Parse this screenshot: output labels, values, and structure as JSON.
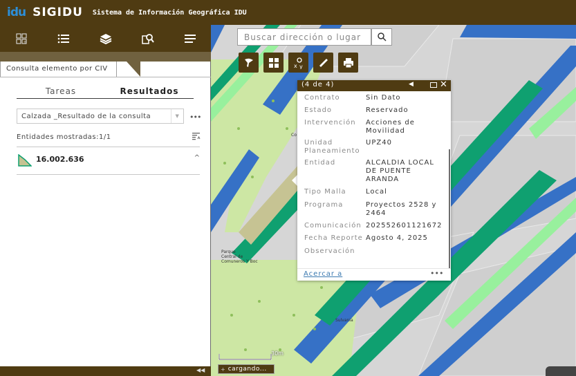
{
  "header": {
    "logo": "idu",
    "title": "SIGIDU",
    "subtitle": "Sistema de Información Geográfica IDU"
  },
  "toolbar": {
    "items": [
      {
        "icon": "widgets-grid-icon"
      },
      {
        "icon": "list-icon"
      },
      {
        "icon": "layers-icon"
      },
      {
        "icon": "query-icon"
      },
      {
        "icon": "menu-icon"
      }
    ]
  },
  "panel": {
    "tab_title": "Consulta elemento por CIV",
    "tabs": [
      "Tareas",
      "Resultados"
    ],
    "active_tab": "Resultados",
    "layer_select": "Calzada _Resultado de la consulta",
    "entities_text": "Entidades mostradas:1/1",
    "result_label": "16.002.636"
  },
  "search": {
    "placeholder": "Buscar dirección o lugar"
  },
  "map_tools": [
    {
      "icon": "draw-icon"
    },
    {
      "icon": "grid-icon"
    },
    {
      "icon": "xy-coordinates-icon"
    },
    {
      "icon": "measure-ruler-icon"
    },
    {
      "icon": "print-icon"
    }
  ],
  "popup": {
    "count": "(4 de 4)",
    "attributes": [
      {
        "key": "Contrato",
        "value": "Sin Dato"
      },
      {
        "key": "Estado",
        "value": "Reservado"
      },
      {
        "key": "Intervención",
        "value": "Acciones de Movilidad"
      },
      {
        "key": "Unidad Planeamiento",
        "value": "UPZ40"
      },
      {
        "key": "Entidad",
        "value": "ALCALDIA LOCAL DE PUENTE ARANDA"
      },
      {
        "key": "Tipo Malla",
        "value": "Local"
      },
      {
        "key": "Programa",
        "value": "Proyectos 2528 y 2464"
      },
      {
        "key": "Comunicación",
        "value": "202552601121672"
      },
      {
        "key": "Fecha Reporte",
        "value": "Agosto 4, 2025"
      },
      {
        "key": "Observación",
        "value": ""
      }
    ],
    "zoom_link": "Acercar a"
  },
  "map": {
    "scale_label": "30m",
    "status": "cargando...",
    "labels": {
      "park_a": "Parque",
      "park_b": "Central de",
      "park_c": "Comuneros Y Boc",
      "street": "Sulvania",
      "co": "Co"
    }
  },
  "colors": {
    "brand_dark": "#4f3b12",
    "road_blue": "#3671c6",
    "road_green": "#0fa070",
    "highlight_green": "#98f09d",
    "park_green": "#cde7a4"
  }
}
